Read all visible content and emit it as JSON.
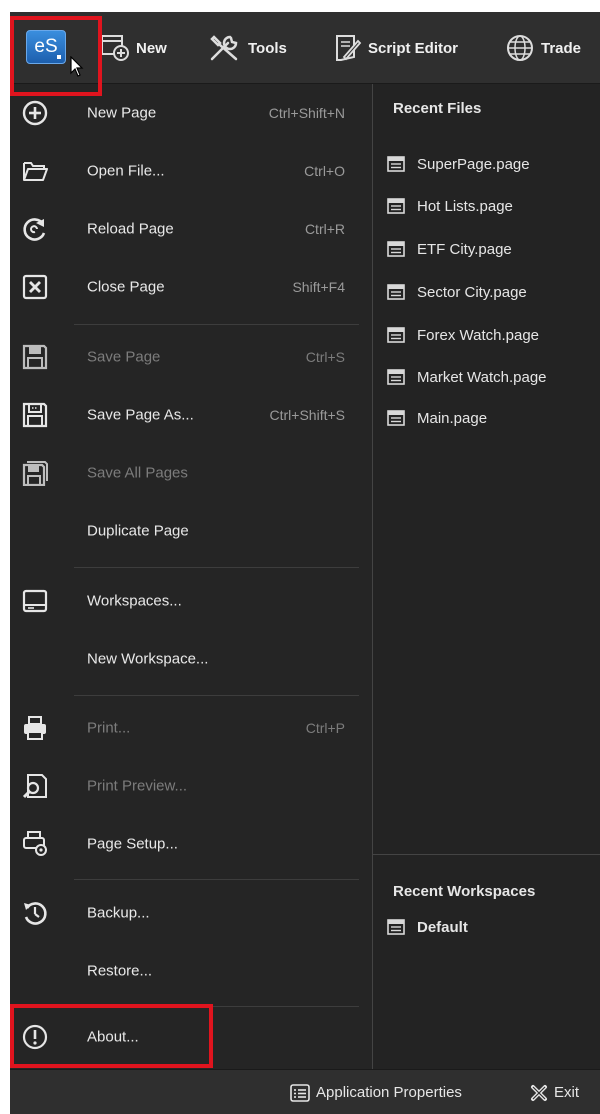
{
  "toolbar": {
    "app_button": "eS",
    "items": [
      {
        "label": "New",
        "icon": "new-page-icon"
      },
      {
        "label": "Tools",
        "icon": "tools-icon"
      },
      {
        "label": "Script Editor",
        "icon": "script-editor-icon"
      },
      {
        "label": "Trade",
        "icon": "trade-globe-icon"
      }
    ]
  },
  "menu": {
    "items": [
      {
        "label": "New Page",
        "shortcut": "Ctrl+Shift+N",
        "icon": "plus-circle-icon"
      },
      {
        "label": "Open File...",
        "shortcut": "Ctrl+O",
        "icon": "folder-open-icon"
      },
      {
        "label": "Reload Page",
        "shortcut": "Ctrl+R",
        "icon": "reload-icon"
      },
      {
        "label": "Close Page",
        "shortcut": "Shift+F4",
        "icon": "close-box-icon"
      },
      {
        "label": "Save Page",
        "shortcut": "Ctrl+S",
        "icon": "save-icon",
        "disabled": true
      },
      {
        "label": "Save Page As...",
        "shortcut": "Ctrl+Shift+S",
        "icon": "save-as-icon"
      },
      {
        "label": "Save All Pages",
        "shortcut": "",
        "icon": "save-all-icon",
        "disabled": true
      },
      {
        "label": "Duplicate Page",
        "shortcut": ""
      },
      {
        "label": "Workspaces...",
        "shortcut": "",
        "icon": "workspace-icon"
      },
      {
        "label": "New Workspace...",
        "shortcut": ""
      },
      {
        "label": "Print...",
        "shortcut": "Ctrl+P",
        "icon": "printer-icon",
        "disabled": true
      },
      {
        "label": "Print Preview...",
        "shortcut": "",
        "icon": "print-preview-icon",
        "disabled": true
      },
      {
        "label": "Page Setup...",
        "shortcut": "",
        "icon": "page-setup-icon"
      },
      {
        "label": "Backup...",
        "shortcut": "",
        "icon": "backup-icon"
      },
      {
        "label": "Restore...",
        "shortcut": ""
      },
      {
        "label": "About...",
        "shortcut": "",
        "icon": "info-circle-icon"
      }
    ]
  },
  "recent_files": {
    "title": "Recent Files",
    "items": [
      "SuperPage.page",
      "Hot Lists.page",
      "ETF City.page",
      "Sector City.page",
      "Forex Watch.page",
      "Market Watch.page",
      "Main.page"
    ]
  },
  "recent_workspaces": {
    "title": "Recent Workspaces",
    "items": [
      "Default"
    ]
  },
  "statusbar": {
    "app_properties": "Application Properties",
    "exit": "Exit"
  },
  "colors": {
    "background": "#252525",
    "highlight_box": "#e0141e",
    "app_button": "#2a7ad0"
  }
}
